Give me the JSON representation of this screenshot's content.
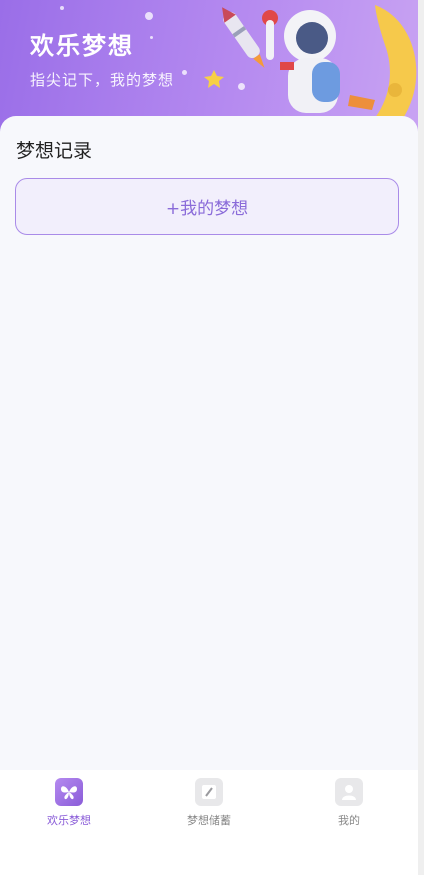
{
  "banner": {
    "title": "欢乐梦想",
    "subtitle": "指尖记下，我的梦想"
  },
  "main": {
    "section_title": "梦想记录",
    "add_button_label": "+我的梦想"
  },
  "tabbar": {
    "items": [
      {
        "label": "欢乐梦想",
        "icon": "butterfly-icon",
        "active": true
      },
      {
        "label": "梦想储蓄",
        "icon": "note-pen-icon",
        "active": false
      },
      {
        "label": "我的",
        "icon": "user-icon",
        "active": false
      }
    ]
  },
  "colors": {
    "accent": "#8a5cd8",
    "banner_start": "#9a6ee8",
    "banner_end": "#c9a4f3",
    "button_border": "#a98be8",
    "button_bg": "#f2effc"
  }
}
